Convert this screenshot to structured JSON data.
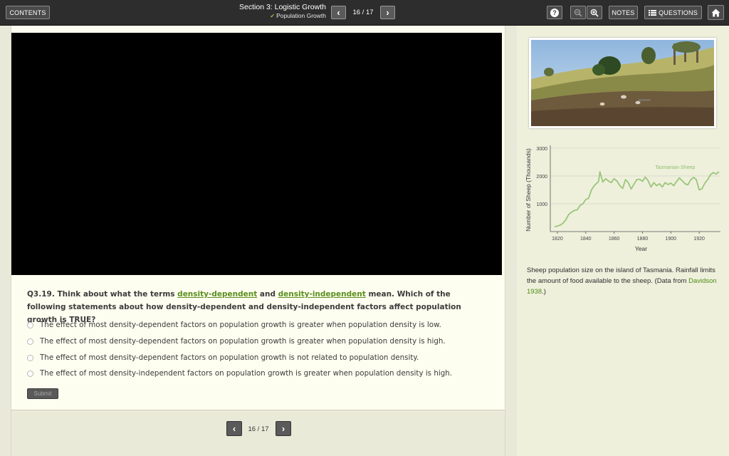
{
  "toolbar": {
    "contents_label": "CONTENTS",
    "section_title": "Section 3: Logistic Growth",
    "subsection_title": "Population Growth",
    "page": "16 / 17",
    "notes_label": "NOTES",
    "questions_label": "QUESTIONS",
    "icons": [
      "help-icon",
      "zoom-out-icon",
      "zoom-in-icon",
      "list-icon",
      "home-icon",
      "chevron-left-icon",
      "chevron-right-icon"
    ]
  },
  "question": {
    "prefix": "Q3.19. Think about what the terms",
    "term1": "density-dependent",
    "mid": "and",
    "term2": "density-independent",
    "suffix": "mean. Which of the following statements about how density-dependent and density-independent factors affect population growth is TRUE?",
    "options": [
      "The effect of most density-dependent factors on population growth is greater when population density is low.",
      "The effect of most density-dependent factors on population growth is greater when population density is high.",
      "The effect of most density-dependent factors on population growth is not related to population density.",
      "The effect of most density-independent factors on population growth is greater when population density is high."
    ],
    "submit_label": "Submit"
  },
  "footer": {
    "page": "16 / 17"
  },
  "chart_data": {
    "type": "line",
    "xlabel": "Year",
    "ylabel": "Number of Sheep (Thousands)",
    "xlim": [
      1815,
      1935
    ],
    "ylim": [
      0,
      3100
    ],
    "x_ticks": [
      "1820",
      "1840",
      "1860",
      "1880",
      "1900",
      "1920"
    ],
    "y_ticks": [
      "1000",
      "2000",
      "3000"
    ],
    "series": [
      {
        "name": "Tasmanian Sheep",
        "color": "#9bc57a",
        "x": [
          1818,
          1820,
          1822,
          1824,
          1826,
          1828,
          1830,
          1832,
          1834,
          1836,
          1838,
          1840,
          1842,
          1844,
          1846,
          1848,
          1849,
          1850,
          1852,
          1854,
          1856,
          1858,
          1860,
          1862,
          1864,
          1866,
          1868,
          1870,
          1872,
          1874,
          1876,
          1878,
          1880,
          1882,
          1884,
          1886,
          1888,
          1890,
          1892,
          1894,
          1896,
          1898,
          1900,
          1902,
          1904,
          1906,
          1908,
          1910,
          1912,
          1914,
          1916,
          1918,
          1920,
          1922,
          1924,
          1926,
          1928,
          1930,
          1932,
          1934
        ],
        "y": [
          170,
          200,
          230,
          300,
          430,
          620,
          700,
          760,
          780,
          940,
          1000,
          1150,
          1200,
          1500,
          1650,
          1750,
          1800,
          2150,
          1780,
          1900,
          1820,
          1760,
          1900,
          1820,
          1650,
          1550,
          1870,
          1760,
          1530,
          1700,
          1870,
          1880,
          1810,
          1960,
          1830,
          1600,
          1760,
          1650,
          1720,
          1600,
          1760,
          1690,
          1740,
          1650,
          1800,
          1930,
          1830,
          1720,
          1680,
          1860,
          1950,
          1870,
          1500,
          1540,
          1740,
          1870,
          2050,
          2120,
          2070,
          2150
        ]
      }
    ]
  },
  "caption": {
    "text": "Sheep population size on the island of Tasmania. Rainfall limits the amount of food available to the sheep. (Data from",
    "citation": "Davidson 1938",
    "end": ".)"
  }
}
